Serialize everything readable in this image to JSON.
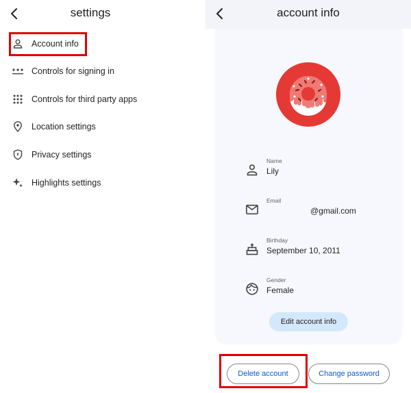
{
  "left_panel": {
    "title": "settings",
    "back_icon": "chevron-left-icon",
    "menu_items": [
      {
        "label": "Account info",
        "icon": "person-icon",
        "highlighted": true
      },
      {
        "label": "Controls for signing in",
        "icon": "password-dots-icon"
      },
      {
        "label": "Controls for third party apps",
        "icon": "apps-grid-icon"
      },
      {
        "label": "Location settings",
        "icon": "location-pin-icon"
      },
      {
        "label": "Privacy settings",
        "icon": "shield-icon"
      },
      {
        "label": "Highlights settings",
        "icon": "sparkle-icon"
      }
    ]
  },
  "right_panel": {
    "title": "account info",
    "back_icon": "chevron-left-icon",
    "avatar": {
      "icon": "donut-icon",
      "bg_color": "#e53935"
    },
    "fields": [
      {
        "label": "Name",
        "value": "Lily",
        "icon": "person-icon"
      },
      {
        "label": "Email",
        "value": "@gmail.com",
        "icon": "mail-icon"
      },
      {
        "label": "Birthday",
        "value": "September 10, 2011",
        "icon": "cake-icon"
      },
      {
        "label": "Gender",
        "value": "Female",
        "icon": "face-icon"
      }
    ],
    "edit_button": "Edit account info",
    "delete_button": "Delete account",
    "change_password_button": "Change password"
  },
  "colors": {
    "highlight": "#e00000",
    "accent_text": "#0b57d0",
    "edit_button_bg": "#d3e8fb",
    "card_bg": "#f7f8fd",
    "header_bg": "#f3f4f9"
  }
}
